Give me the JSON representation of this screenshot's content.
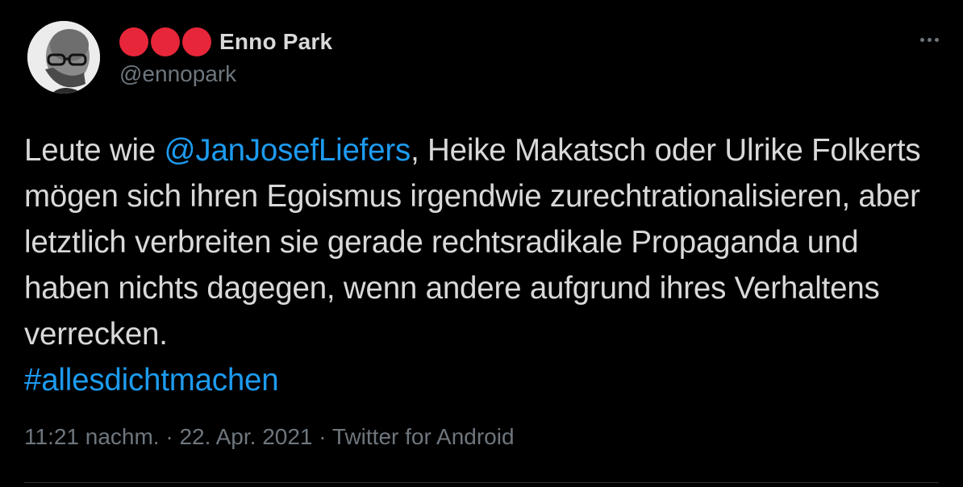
{
  "tweet": {
    "display_name": "Enno Park",
    "handle": "@ennopark",
    "name_emoji_count": 3,
    "text_segments": {
      "t1": "Leute wie ",
      "mention": "@JanJosefLiefers",
      "t2": ", Heike Makatsch oder Ulrike Folkerts mögen sich ihren Egoismus irgendwie zurechtrationalisieren, aber letztlich verbreiten sie gerade rechtsradikale Propaganda und haben nichts dagegen, wenn andere aufgrund ihres Verhaltens verrecken.",
      "hashtag": "#allesdichtmachen"
    },
    "meta": "11:21 nachm. · 22. Apr. 2021 · Twitter for Android",
    "more_icon": "more-horizontal-icon"
  },
  "colors": {
    "background": "#000000",
    "text": "#d9d9d9",
    "secondary": "#6e767d",
    "link": "#1d9bf0",
    "emoji_red": "#e8263a"
  }
}
